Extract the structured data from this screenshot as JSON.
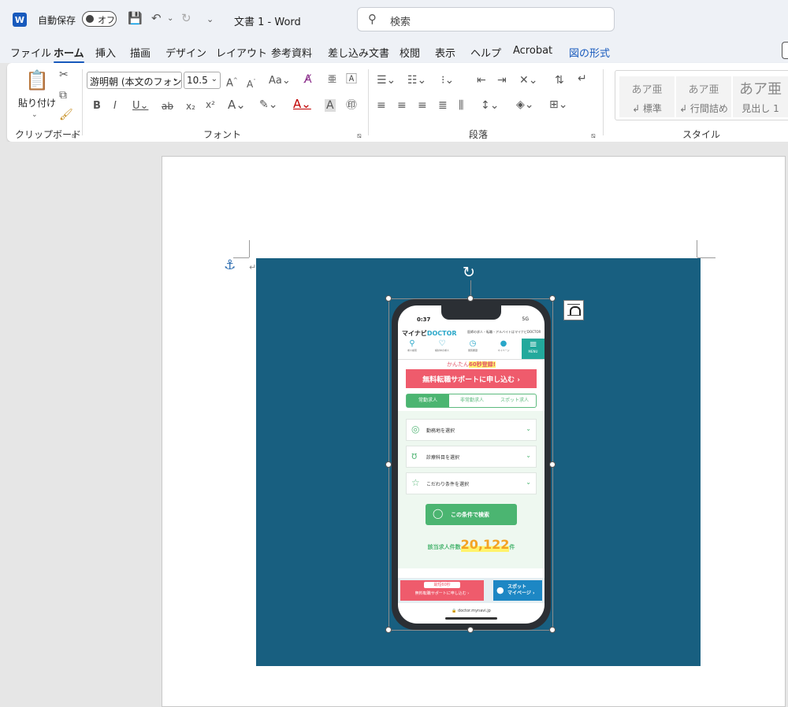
{
  "titlebar": {
    "app_icon": "word-icon",
    "autosave_label": "自動保存",
    "autosave_state": "オフ",
    "doc_title": "文書 1  -  Word",
    "search_placeholder": "検索"
  },
  "tabs": [
    "ファイル",
    "ホーム",
    "挿入",
    "描画",
    "デザイン",
    "レイアウト",
    "参考資料",
    "差し込み文書",
    "校閲",
    "表示",
    "ヘルプ",
    "Acrobat",
    "図の形式"
  ],
  "active_tab": "ホーム",
  "ribbon": {
    "clipboard": {
      "paste_label": "貼り付け",
      "group_label": "クリップボード"
    },
    "font": {
      "font_name": "游明朝 (本文のフォン",
      "font_size": "10.5",
      "group_label": "フォント"
    },
    "paragraph": {
      "group_label": "段落"
    },
    "styles": {
      "group_label": "スタイル",
      "items": [
        {
          "sample": "あア亜",
          "name": "↲ 標準"
        },
        {
          "sample": "あア亜",
          "name": "↲ 行間詰め"
        },
        {
          "sample": "あア亜",
          "name": "見出し 1"
        }
      ]
    }
  },
  "colors": {
    "accent": "#185abd",
    "image_bg": "#185f80",
    "site_green": "#4bb571",
    "site_red": "#ef5b6c"
  },
  "phone": {
    "time": "0:37",
    "signal": "5G",
    "logo_a": "マイナビ",
    "logo_b": "DOCTOR",
    "tagline": "医師の求人・転職・アルバイトはマイナビDOCTOR",
    "nav": [
      "求人検索",
      "検討中の求人",
      "閲覧履歴",
      "マイページ"
    ],
    "menu": "MENU",
    "promo_a": "かんたん",
    "promo_b": "60秒登録!",
    "cta": "無料転職サポートに申し込む ›",
    "segments": [
      "常勤求人",
      "非常勤求人",
      "スポット求人"
    ],
    "fields": [
      "勤務地を選択",
      "診療科目を選択",
      "こだわり条件を選択"
    ],
    "search_button": "この条件で検索",
    "count_label": "該当求人件数",
    "count_value": "20,122",
    "count_unit": "件",
    "bottom_badge": "最短60秒",
    "bottom_cta": "無料転職サポートに申し込む ›",
    "spot_line1": "スポット",
    "spot_line2": "マイページ ›",
    "url": "🔒 doctor.mynavi.jp"
  }
}
